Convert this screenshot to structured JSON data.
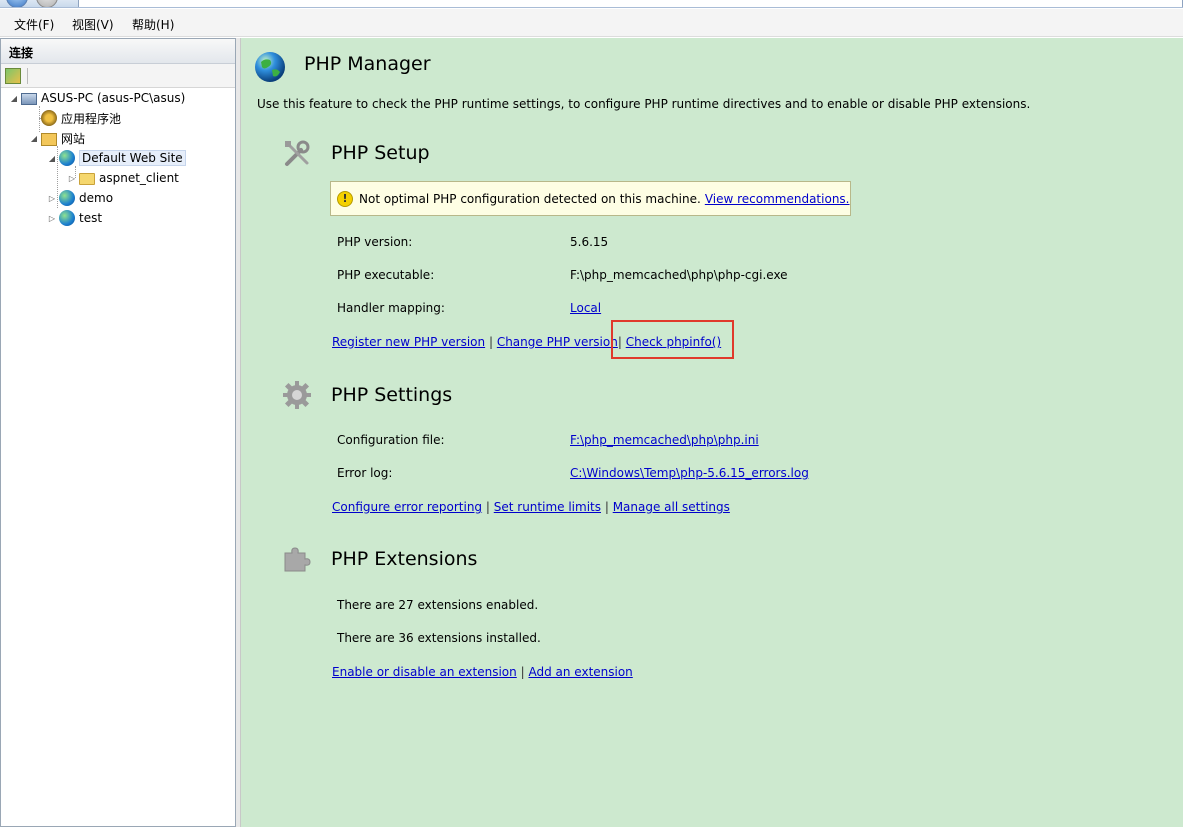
{
  "menu": {
    "file": "文件(F)",
    "view": "视图(V)",
    "help": "帮助(H)"
  },
  "left_pane": {
    "header": "连接",
    "tree": {
      "server": "ASUS-PC (asus-PC\\asus)",
      "app_pools": "应用程序池",
      "sites": "网站",
      "default_site": "Default Web Site",
      "aspnet_client": "aspnet_client",
      "demo": "demo",
      "test": "test"
    }
  },
  "main": {
    "title": "PHP Manager",
    "description": "Use this feature to check the PHP runtime settings, to configure PHP runtime directives and to enable or disable PHP extensions.",
    "setup": {
      "heading": "PHP Setup",
      "warning_text": "Not optimal PHP configuration detected on this machine.",
      "warning_link": "View recommendations.",
      "version_label": "PHP version:",
      "version_value": "5.6.15",
      "executable_label": "PHP executable:",
      "executable_value": "F:\\php_memcached\\php\\php-cgi.exe",
      "handler_label": "Handler mapping:",
      "handler_value": "Local",
      "links": {
        "register": "Register new PHP version",
        "change": "Change PHP version",
        "phpinfo": "Check phpinfo()"
      }
    },
    "settings": {
      "heading": "PHP Settings",
      "config_label": "Configuration file:",
      "config_value": "F:\\php_memcached\\php\\php.ini",
      "errorlog_label": "Error log:",
      "errorlog_value": "C:\\Windows\\Temp\\php-5.6.15_errors.log",
      "links": {
        "error_reporting": "Configure error reporting",
        "runtime_limits": "Set runtime limits",
        "manage_all": "Manage all settings"
      }
    },
    "extensions": {
      "heading": "PHP Extensions",
      "enabled_text": "There are 27 extensions enabled.",
      "installed_text": "There are 36 extensions installed.",
      "links": {
        "enable_disable": "Enable or disable an extension",
        "add": "Add an extension"
      }
    },
    "separator": "|"
  },
  "colors": {
    "main_bg": "#cde9cf",
    "link": "#0000cc",
    "highlight_box": "#e0392b",
    "warning_bg": "#fefee4"
  }
}
